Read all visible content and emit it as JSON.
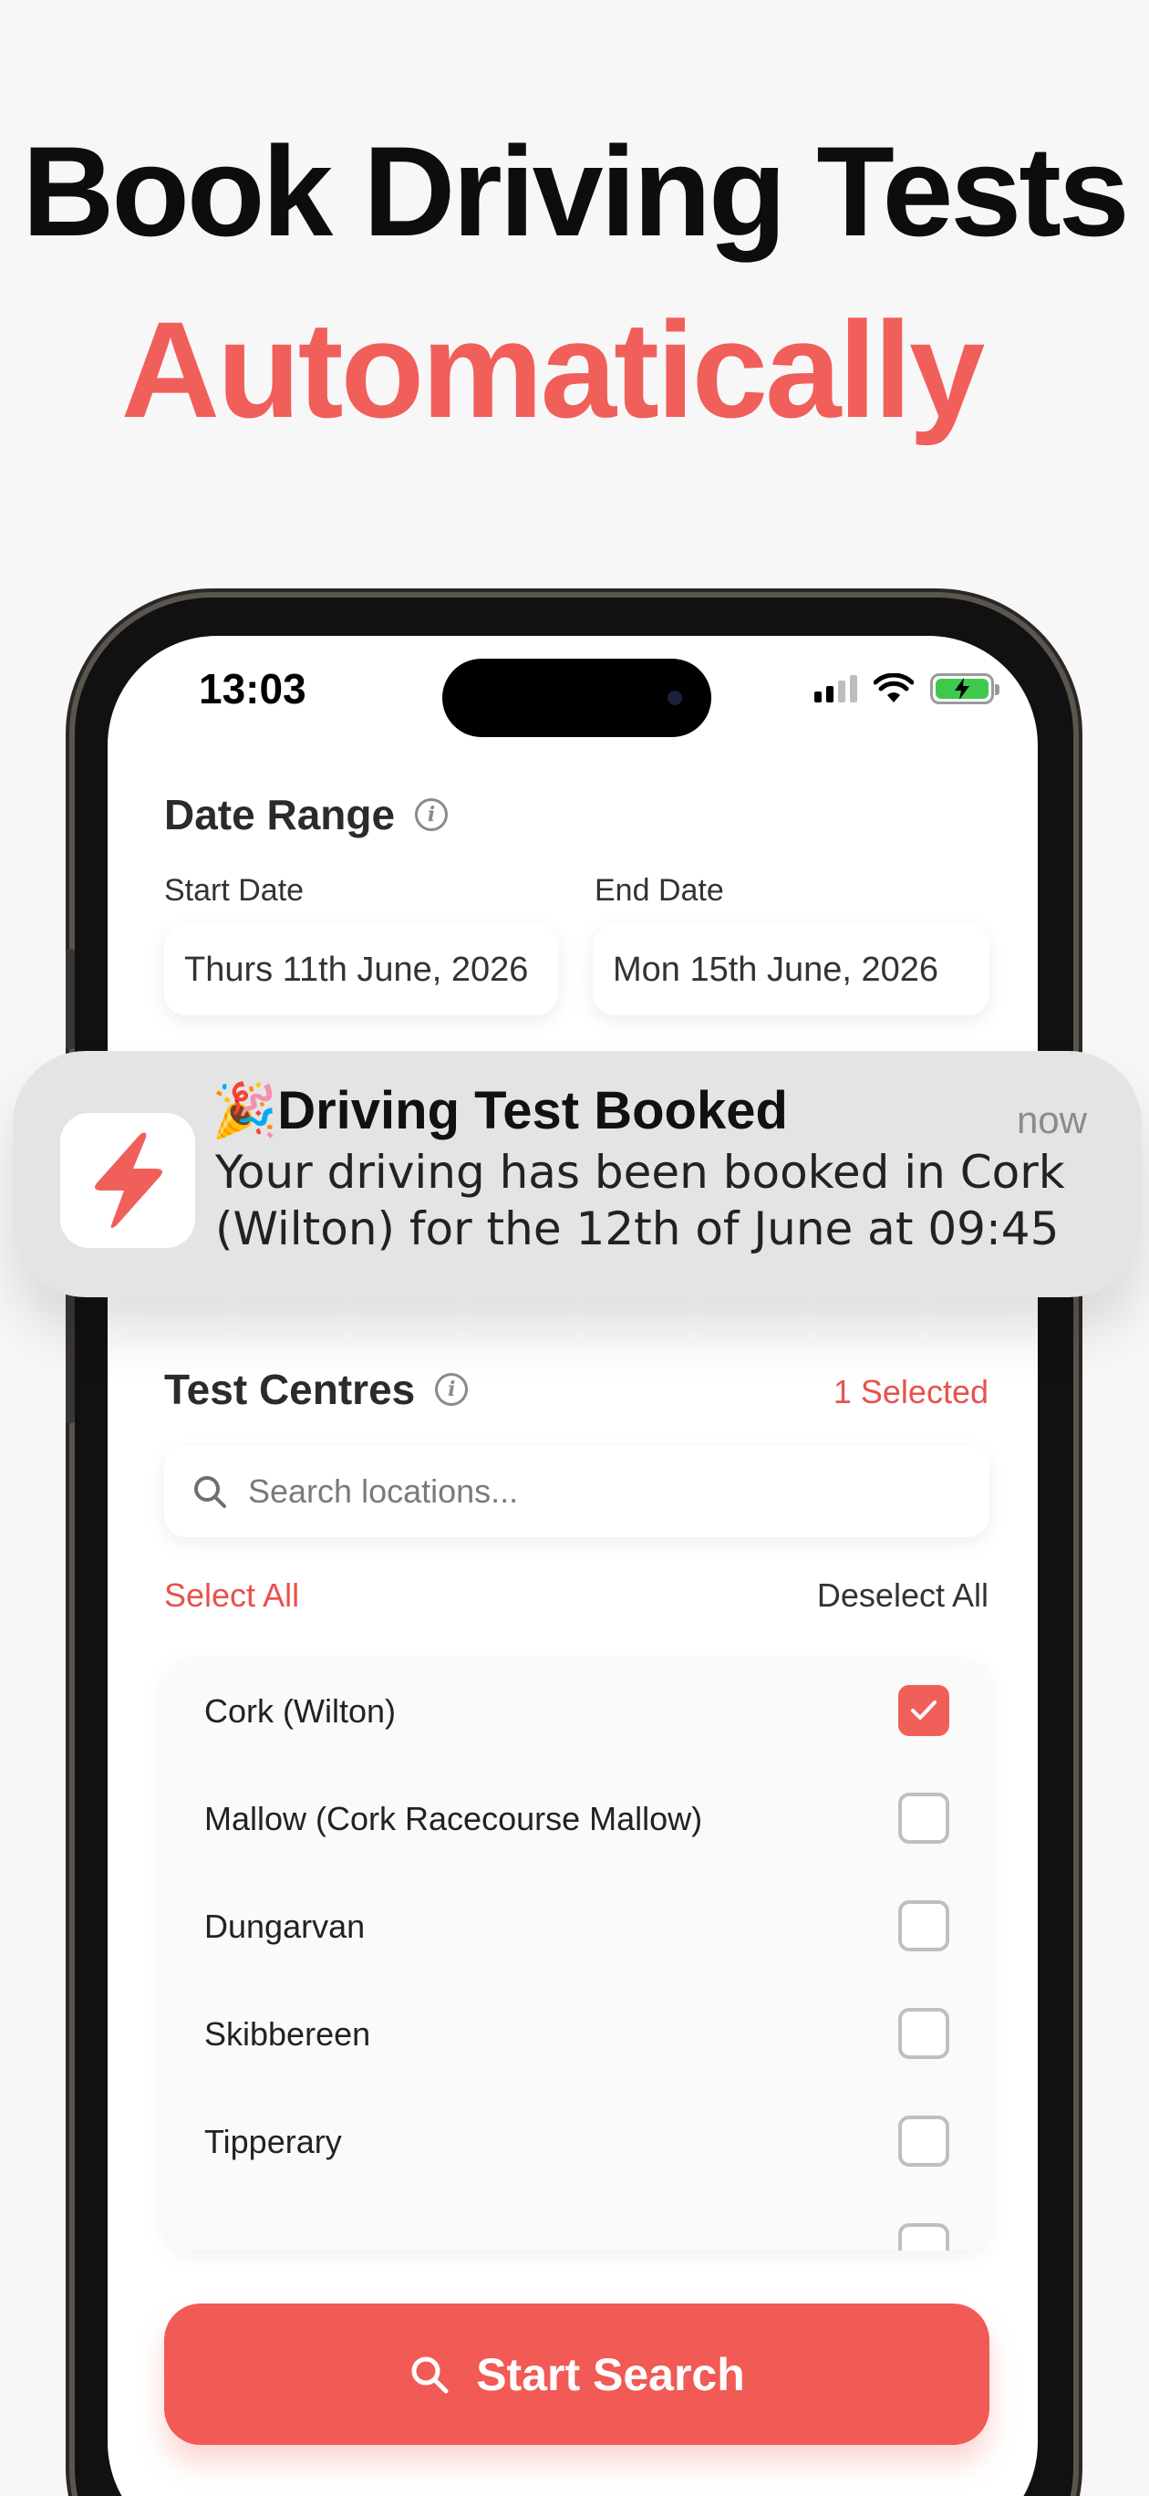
{
  "headline": {
    "line1": "Book Driving Tests",
    "line2": "Automatically"
  },
  "status_bar": {
    "time": "13:03"
  },
  "date_range": {
    "title": "Date Range",
    "start_label": "Start Date",
    "start_value": "Thurs 11th June, 2026",
    "end_label": "End Date",
    "end_value": "Mon 15th June, 2026"
  },
  "notification": {
    "emoji": "🎉",
    "title": "Driving Test Booked",
    "time": "now",
    "body": "Your driving has been booked in Cork (Wilton) for the 12th of June at 09:45"
  },
  "test_centres": {
    "title": "Test Centres",
    "selected_count": "1 Selected",
    "search_placeholder": "Search locations...",
    "select_all": "Select All",
    "deselect_all": "Deselect All",
    "items": [
      {
        "label": "Cork (Wilton)",
        "checked": true
      },
      {
        "label": "Mallow (Cork Racecourse Mallow)",
        "checked": false
      },
      {
        "label": "Dungarvan",
        "checked": false
      },
      {
        "label": "Skibbereen",
        "checked": false
      },
      {
        "label": "Tipperary",
        "checked": false
      }
    ]
  },
  "start_button": {
    "label": "Start Search"
  },
  "colors": {
    "accent": "#f15f5a",
    "headline": "#0d0d0d"
  }
}
